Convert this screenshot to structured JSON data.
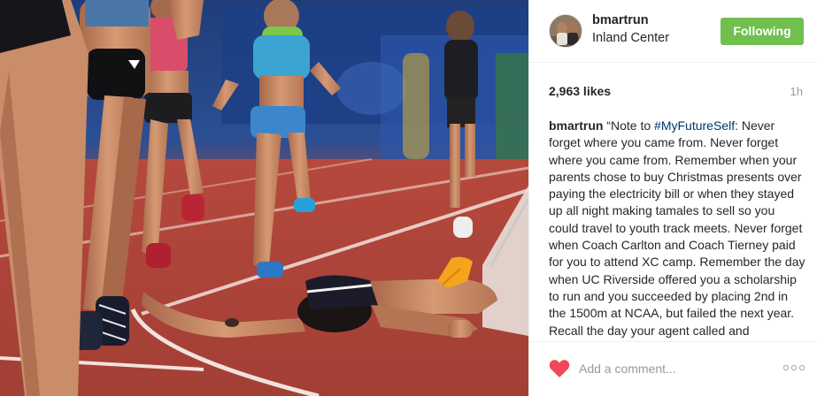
{
  "post": {
    "user": {
      "username": "bmartrun",
      "location": "Inland Center",
      "follow_label": "Following"
    },
    "likes": "2,963 likes",
    "time": "1h",
    "caption": {
      "username": "bmartrun",
      "before_tag": "“Note to ",
      "hashtag": "#MyFutureSelf",
      "text": ": Never forget where you came from. Never forget where you came from. Remember when your parents chose to buy Christmas presents over paying the electricity bill or when they stayed up all night making tamales to sell so you could travel to youth track meets. Never forget when Coach Carlton and Coach Tierney paid for you to attend XC camp. Remember the day when UC Riverside offered you a scholarship to run and you succeeded by placing 2nd in the 1500m at NCAA, but failed the next year. Recall the day your agent called and"
    },
    "comment_placeholder": "Add a comment...",
    "icons": {
      "like": "heart-icon",
      "more": "more-options-icon"
    },
    "colors": {
      "follow_button": "#70c050",
      "heart": "#ed4956",
      "hashtag": "#003569",
      "secondary_text": "#999999"
    }
  }
}
